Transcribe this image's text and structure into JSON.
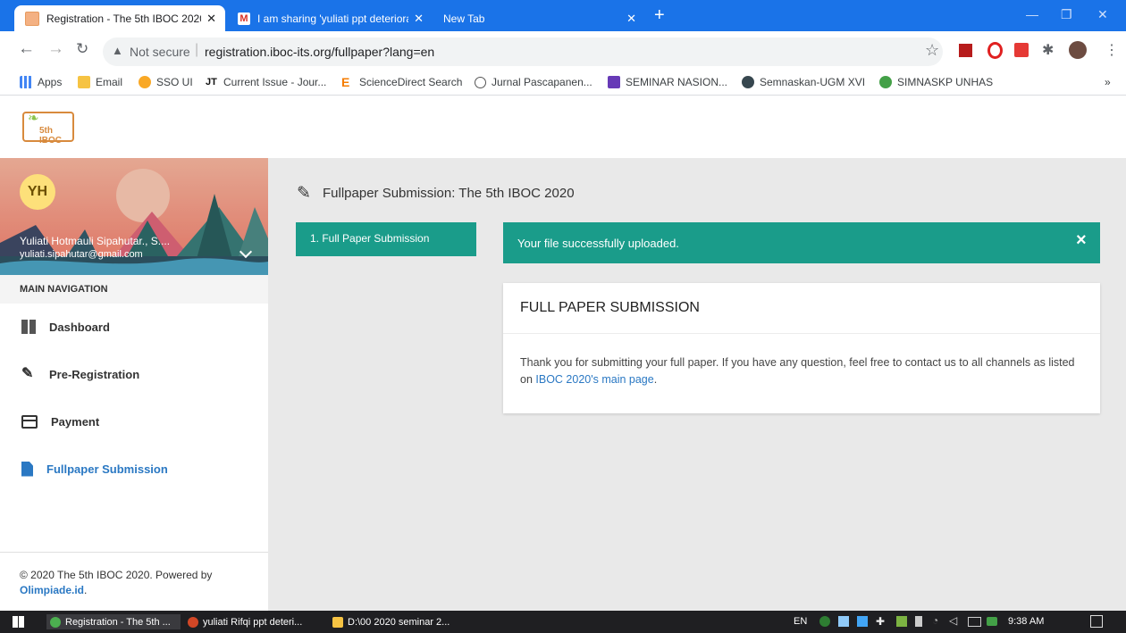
{
  "browser": {
    "tabs": [
      {
        "title": "Registration - The 5th IBOC 2020",
        "active": true
      },
      {
        "title": "I am sharing 'yuliati ppt deteriora",
        "active": false
      },
      {
        "title": "New Tab",
        "active": false
      }
    ],
    "tab_close": "✕",
    "address": {
      "security": "Not secure",
      "url": "registration.iboc-its.org/fullpaper?lang=en"
    },
    "bookmarks": [
      "Apps",
      "Email",
      "SSO UI",
      "Current Issue - Jour...",
      "ScienceDirect Search",
      "Jurnal Pascapanen...",
      "SEMINAR NASION...",
      "Semnaskan-UGM XVI",
      "SIMNASKP UNHAS"
    ],
    "bookmarks_more": "»"
  },
  "app": {
    "logo_text": "5th IBOC",
    "user": {
      "initials": "YH",
      "name": "Yuliati Hotmauli Sipahutar., S....",
      "email": "yuliati.sipahutar@gmail.com"
    },
    "nav_header": "MAIN NAVIGATION",
    "nav": [
      {
        "label": "Dashboard",
        "icon": "dashboard-icon",
        "active": false
      },
      {
        "label": "Pre-Registration",
        "icon": "pencil-icon",
        "active": false
      },
      {
        "label": "Payment",
        "icon": "card-icon",
        "active": false
      },
      {
        "label": "Fullpaper Submission",
        "icon": "document-icon",
        "active": true
      }
    ],
    "footer": {
      "text": "© 2020 The 5th IBOC 2020. Powered by",
      "link": "Olimpiade.id",
      "period": "."
    },
    "page_title": "Fullpaper Submission: The 5th IBOC 2020",
    "step": "1. Full Paper Submission",
    "alert": "Your file successfully uploaded.",
    "alert_close": "×",
    "card": {
      "title": "FULL PAPER SUBMISSION",
      "text_before": "Thank you for submitting your full paper. If you have any question, feel free to contact us to all channels as listed on ",
      "link": "IBOC 2020's main page",
      "text_after": "."
    },
    "colors": {
      "accent": "#1a9c8a",
      "blue": "#2a78c3"
    }
  },
  "taskbar": {
    "items": [
      "Registration - The 5th ...",
      "yuliati  Rifqi ppt deteri...",
      "D:\\00 2020 seminar 2..."
    ],
    "lang": "EN",
    "time": "9:38 AM"
  }
}
